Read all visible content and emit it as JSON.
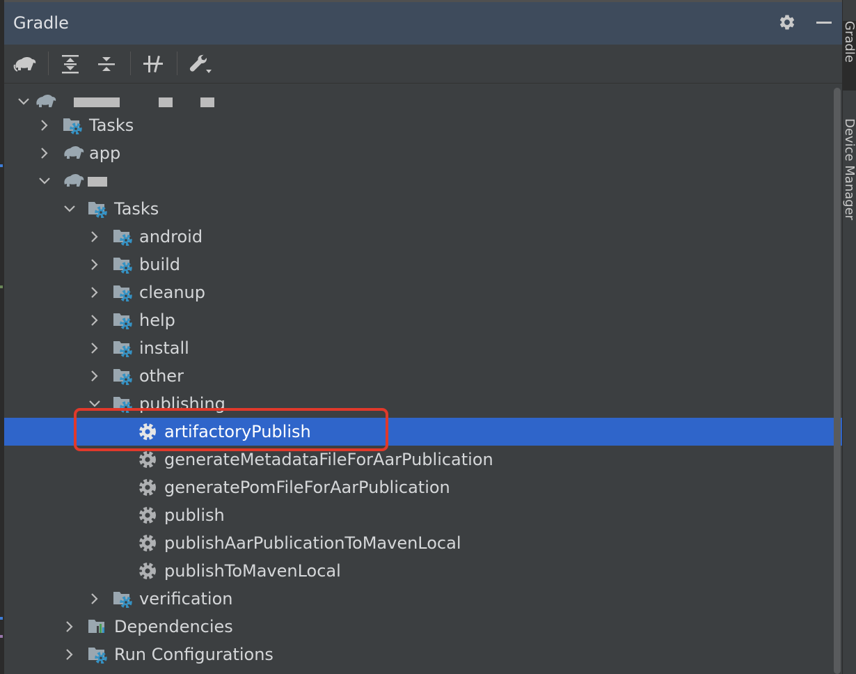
{
  "header": {
    "title": "Gradle"
  },
  "toolbar": {
    "buttons": [
      {
        "icon": "elephant-refresh-icon",
        "tooltip": ""
      },
      {
        "icon": "expand-all-icon"
      },
      {
        "icon": "collapse-all-icon"
      },
      {
        "icon": "toggle-offline-mode-icon"
      },
      {
        "icon": "build-tool-settings-icon"
      }
    ]
  },
  "tree": {
    "items": [
      {
        "label": "",
        "icon": "gradle-elephant-icon",
        "expanded": true,
        "redacted": true
      },
      {
        "label": "Tasks",
        "icon": "task-folder-icon",
        "expanded": false
      },
      {
        "label": "app",
        "icon": "gradle-elephant-icon",
        "expanded": false
      },
      {
        "label": "",
        "icon": "gradle-elephant-icon",
        "expanded": true,
        "redacted": true
      },
      {
        "label": "Tasks",
        "icon": "task-folder-icon",
        "expanded": true
      },
      {
        "label": "android",
        "icon": "task-folder-icon",
        "expanded": false
      },
      {
        "label": "build",
        "icon": "task-folder-icon",
        "expanded": false
      },
      {
        "label": "cleanup",
        "icon": "task-folder-icon",
        "expanded": false
      },
      {
        "label": "help",
        "icon": "task-folder-icon",
        "expanded": false
      },
      {
        "label": "install",
        "icon": "task-folder-icon",
        "expanded": false
      },
      {
        "label": "other",
        "icon": "task-folder-icon",
        "expanded": false
      },
      {
        "label": "publishing",
        "icon": "task-folder-icon",
        "expanded": true
      },
      {
        "label": "artifactoryPublish",
        "icon": "gear-icon",
        "selected": true
      },
      {
        "label": "generateMetadataFileForAarPublication",
        "icon": "gear-icon"
      },
      {
        "label": "generatePomFileForAarPublication",
        "icon": "gear-icon"
      },
      {
        "label": "publish",
        "icon": "gear-icon"
      },
      {
        "label": "publishAarPublicationToMavenLocal",
        "icon": "gear-icon"
      },
      {
        "label": "publishToMavenLocal",
        "icon": "gear-icon"
      },
      {
        "label": "verification",
        "icon": "task-folder-icon",
        "expanded": false
      },
      {
        "label": "Dependencies",
        "icon": "dependencies-icon",
        "expanded": false
      },
      {
        "label": "Run Configurations",
        "icon": "task-folder-icon",
        "expanded": false
      }
    ]
  },
  "side_tabs": [
    {
      "label": "Gradle",
      "active": true
    },
    {
      "label": "Device Manager",
      "active": false
    }
  ],
  "colors": {
    "selection": "#2f65ca",
    "highlight_box": "#e0392b",
    "task_gear_accent": "#3592c4"
  }
}
